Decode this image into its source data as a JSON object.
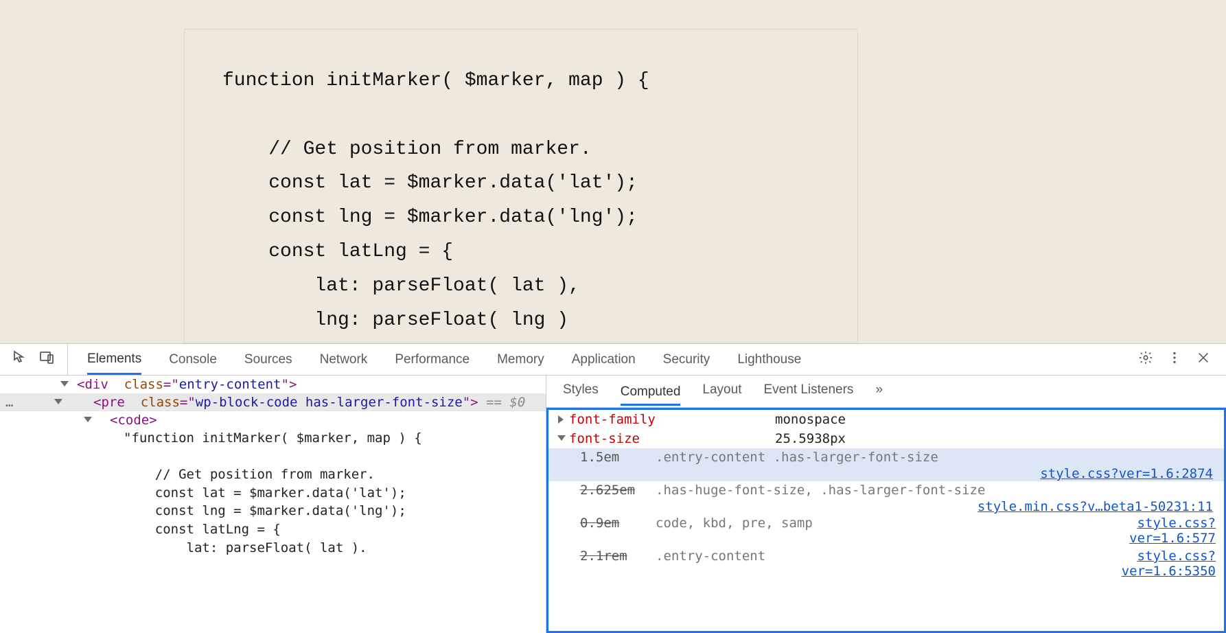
{
  "page": {
    "code": "function initMarker( $marker, map ) {\n\n    // Get position from marker.\n    const lat = $marker.data('lat');\n    const lng = $marker.data('lng');\n    const latLng = {\n        lat: parseFloat( lat ),\n        lng: parseFloat( lng )"
  },
  "devtools": {
    "tabs": [
      "Elements",
      "Console",
      "Sources",
      "Network",
      "Performance",
      "Memory",
      "Application",
      "Security",
      "Lighthouse"
    ],
    "activeTab": "Elements"
  },
  "dom": {
    "dots": "…",
    "row1_div_open": {
      "ang_open": "<",
      "tag": "div",
      "attr": "class",
      "attr_q_open": "=\"",
      "val": "entry-content",
      "attr_q_close": "\"",
      "ang_close": ">"
    },
    "row2_pre_open": {
      "ang_open": "<",
      "tag": "pre",
      "attr": "class",
      "attr_q_open": "=\"",
      "val": "wp-block-code has-larger-font-size",
      "attr_q_close": "\"",
      "ang_close": ">",
      "eqsel": " == $0"
    },
    "row3_code_open": {
      "ang_open": "<",
      "tag": "code",
      "ang_close": ">"
    },
    "code_text": "\"function initMarker( $marker, map ) {\n\n    // Get position from marker.\n    const lat = $marker.data('lat');\n    const lng = $marker.data('lng');\n    const latLng = {\n        lat: parseFloat( lat )."
  },
  "stylesPanel": {
    "tabs": [
      "Styles",
      "Computed",
      "Layout",
      "Event Listeners"
    ],
    "more": "»",
    "activeTab": "Computed"
  },
  "computed": {
    "props": [
      {
        "name": "font-family",
        "val": "monospace",
        "expanded": false
      },
      {
        "name": "font-size",
        "val": "25.5938px",
        "expanded": true
      }
    ],
    "sources": [
      {
        "value": "1.5em",
        "selector": ".entry-content .has-larger-font-size",
        "link": "style.css?ver=1.6:2874",
        "strike": false,
        "selected": true
      },
      {
        "value": "2.625em",
        "selector": ".has-huge-font-size, .has-larger-font-size",
        "link": "style.min.css?v…beta1-50231:11",
        "strike": true,
        "selected": false
      },
      {
        "value": "0.9em",
        "selector": "code, kbd, pre, samp",
        "link": "style.css?ver=1.6:577",
        "strike": true,
        "selected": false
      },
      {
        "value": "2.1rem",
        "selector": ".entry-content",
        "link": "style.css?ver=1.6:5350",
        "strike": true,
        "selected": false
      }
    ]
  }
}
